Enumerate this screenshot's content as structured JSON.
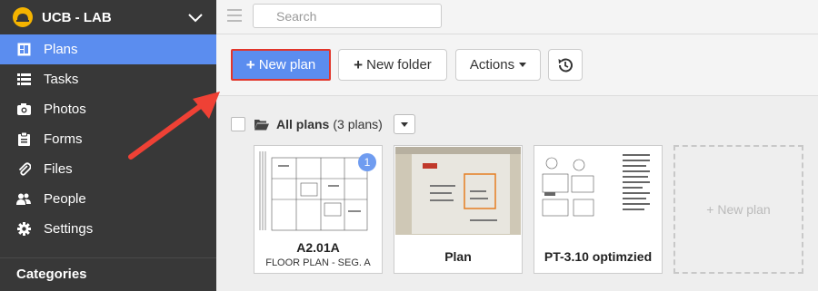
{
  "sidebar": {
    "project_name": "UCB - LAB",
    "items": [
      {
        "label": "Plans",
        "icon": "plans-icon",
        "active": true
      },
      {
        "label": "Tasks",
        "icon": "list-icon"
      },
      {
        "label": "Photos",
        "icon": "camera-icon"
      },
      {
        "label": "Forms",
        "icon": "clipboard-icon"
      },
      {
        "label": "Files",
        "icon": "paperclip-icon"
      },
      {
        "label": "People",
        "icon": "people-icon"
      },
      {
        "label": "Settings",
        "icon": "gear-icon"
      }
    ],
    "categories_label": "Categories"
  },
  "search": {
    "placeholder": "Search"
  },
  "toolbar": {
    "new_plan_label": "New plan",
    "new_folder_label": "New folder",
    "actions_label": "Actions"
  },
  "list": {
    "title": "All plans",
    "count": "(3 plans)"
  },
  "plans": [
    {
      "title": "A2.01A",
      "subtitle": "FLOOR PLAN - SEG. A",
      "badge": "1"
    },
    {
      "title": "Plan",
      "subtitle": ""
    },
    {
      "title": "PT-3.10 optimzied",
      "subtitle": ""
    }
  ],
  "new_plan_card": "+ New plan",
  "colors": {
    "sidebar_bg": "#383838",
    "accent": "#5b8def",
    "highlight": "#e2362b",
    "logo": "#f5b400"
  }
}
